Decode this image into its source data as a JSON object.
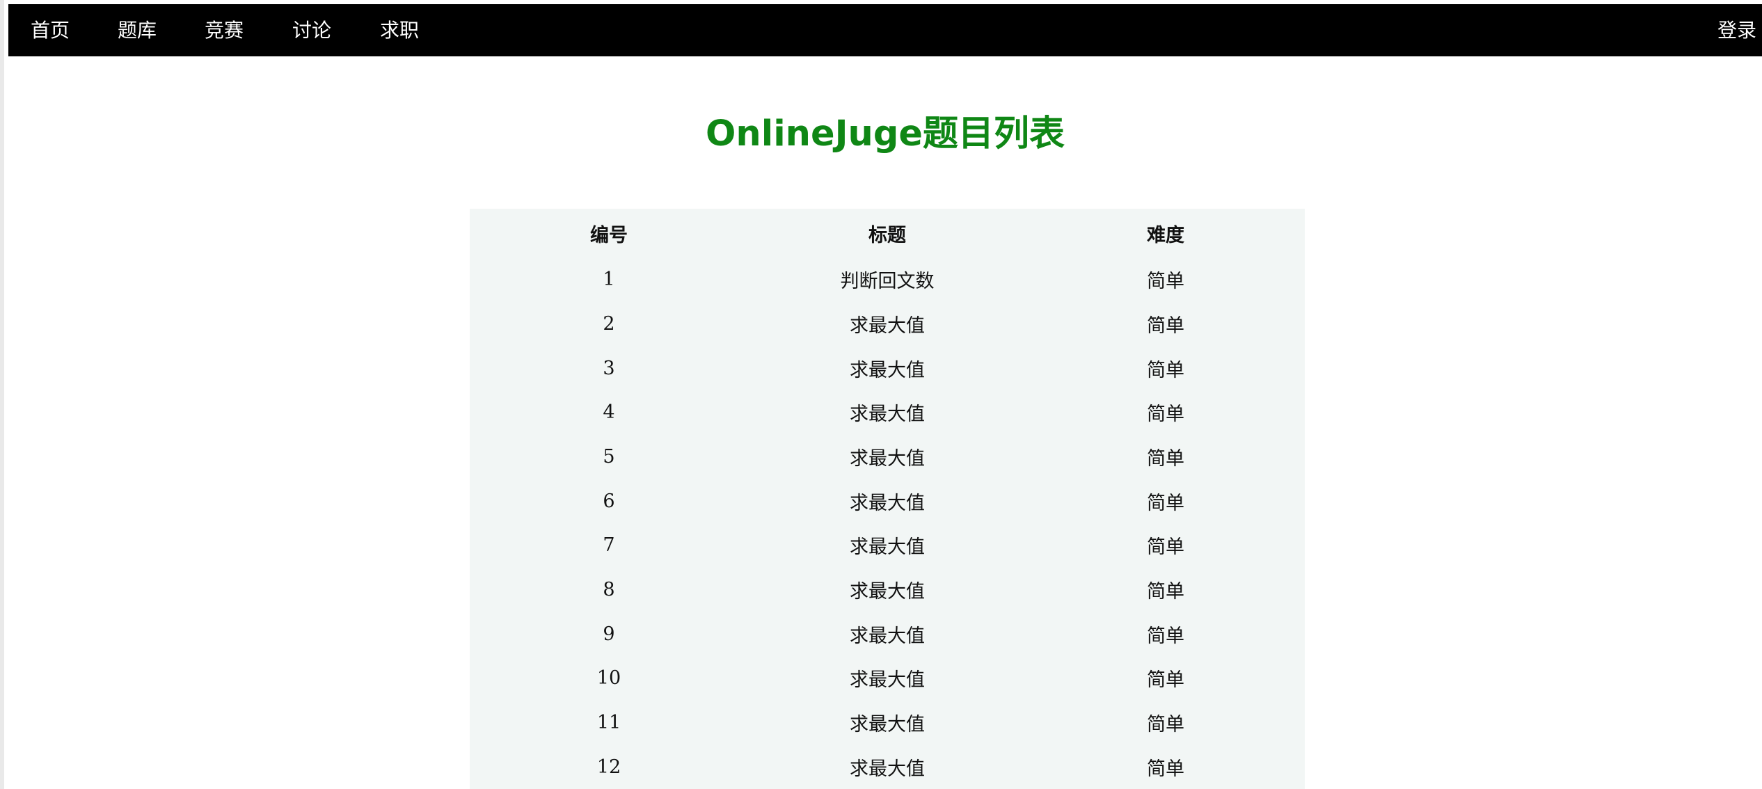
{
  "nav": {
    "home": "首页",
    "problems": "题库",
    "contest": "竞赛",
    "discuss": "讨论",
    "jobs": "求职",
    "login": "登录"
  },
  "page": {
    "title": "OnlineJuge题目列表"
  },
  "table": {
    "headers": {
      "id": "编号",
      "title": "标题",
      "difficulty": "难度"
    },
    "rows": [
      {
        "id": "1",
        "title": "判断回文数",
        "difficulty": "简单"
      },
      {
        "id": "2",
        "title": "求最大值",
        "difficulty": "简单"
      },
      {
        "id": "3",
        "title": "求最大值",
        "difficulty": "简单"
      },
      {
        "id": "4",
        "title": "求最大值",
        "difficulty": "简单"
      },
      {
        "id": "5",
        "title": "求最大值",
        "difficulty": "简单"
      },
      {
        "id": "6",
        "title": "求最大值",
        "difficulty": "简单"
      },
      {
        "id": "7",
        "title": "求最大值",
        "difficulty": "简单"
      },
      {
        "id": "8",
        "title": "求最大值",
        "difficulty": "简单"
      },
      {
        "id": "9",
        "title": "求最大值",
        "difficulty": "简单"
      },
      {
        "id": "10",
        "title": "求最大值",
        "difficulty": "简单"
      },
      {
        "id": "11",
        "title": "求最大值",
        "difficulty": "简单"
      },
      {
        "id": "12",
        "title": "求最大值",
        "difficulty": "简单"
      }
    ]
  },
  "colors": {
    "navbar_background": "#000000",
    "nav_text": "#ffffff",
    "title": "#0f8715",
    "table_background": "#f2f6f5"
  }
}
